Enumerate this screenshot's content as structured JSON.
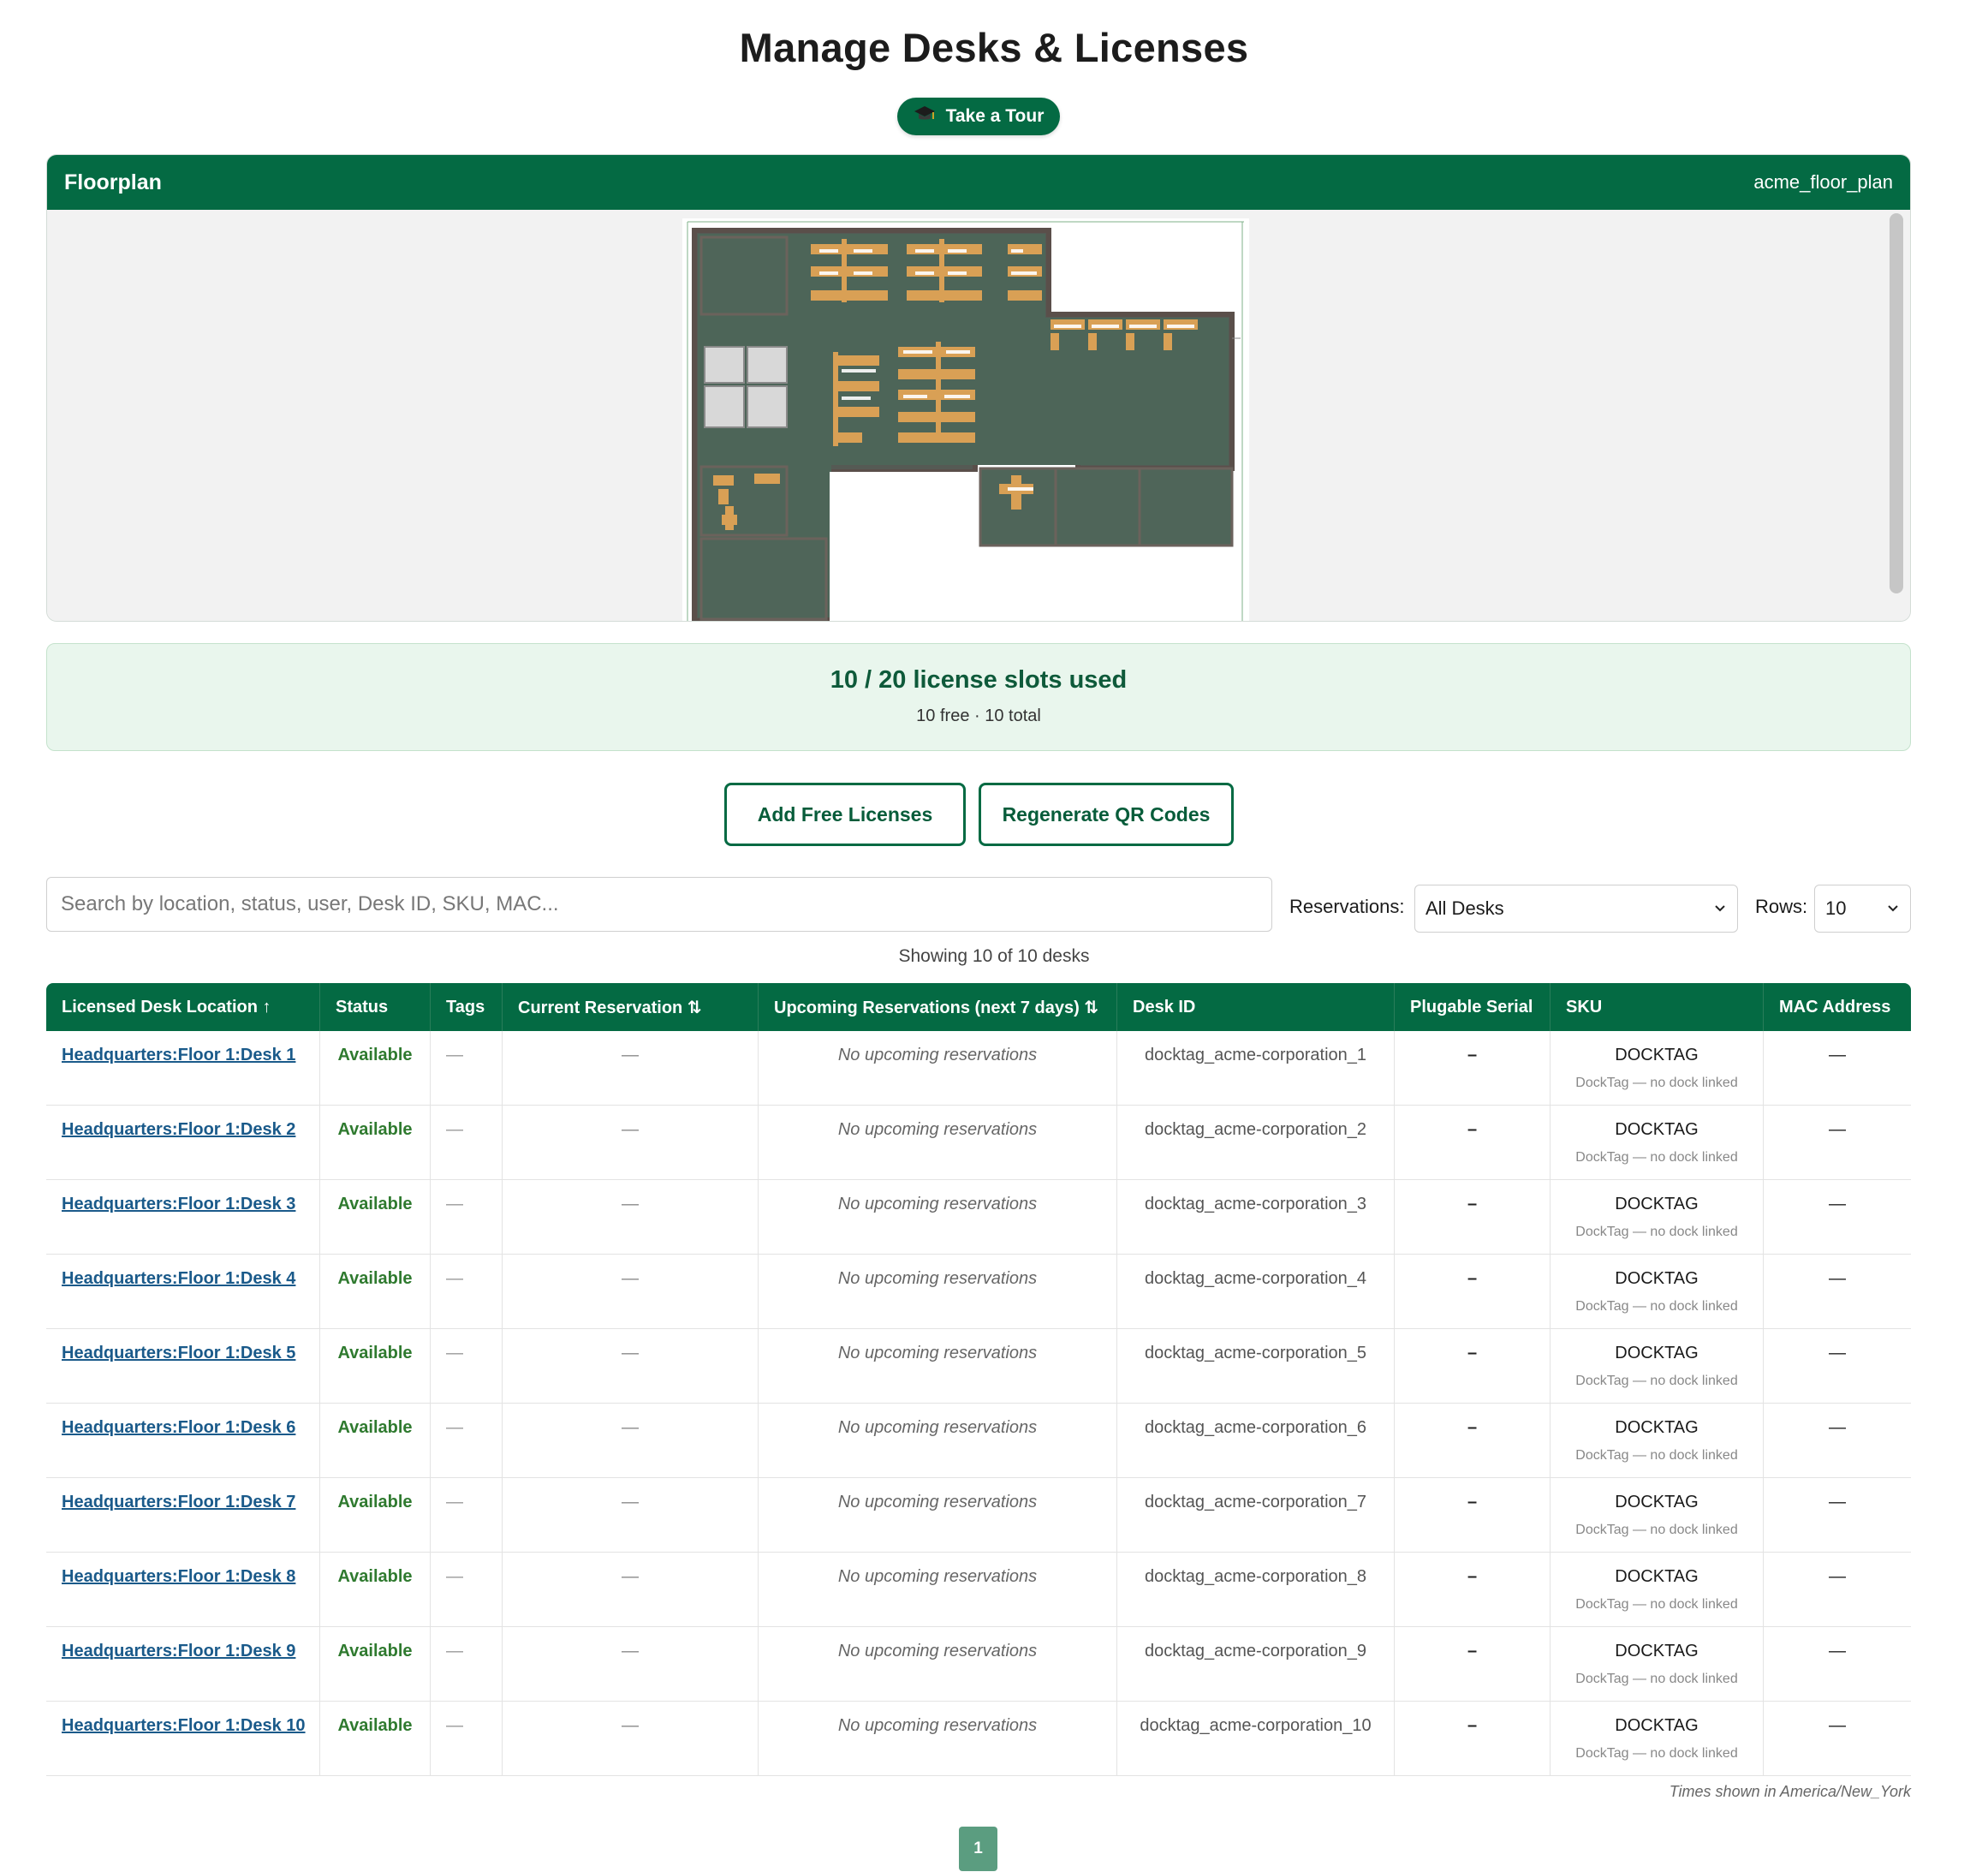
{
  "page": {
    "title": "Manage Desks & Licenses"
  },
  "tour": {
    "label": "Take a Tour",
    "icon": "graduation-cap-icon"
  },
  "floorplan": {
    "title": "Floorplan",
    "name": "acme_floor_plan"
  },
  "license": {
    "summary": "10 / 20 license slots used",
    "detail": "10 free · 10 total"
  },
  "actions": {
    "add_label": "Add Free Licenses",
    "regen_label": "Regenerate QR Codes"
  },
  "search": {
    "placeholder": "Search by location, status, user, Desk ID, SKU, MAC..."
  },
  "filters": {
    "reservations_label": "Reservations:",
    "reservations_value": "All Desks",
    "rows_label": "Rows:",
    "rows_value": "10"
  },
  "showing": "Showing 10 of 10 desks",
  "table": {
    "columns": [
      "Licensed Desk Location ↑",
      "Status",
      "Tags",
      "Current Reservation ⇅",
      "Upcoming Reservations (next 7 days) ⇅",
      "Desk ID",
      "Plugable Serial",
      "SKU",
      "MAC Address"
    ],
    "rows": [
      {
        "location": "Headquarters:Floor 1:Desk 1",
        "status": "Available",
        "tags": "—",
        "current": "—",
        "upcoming": "No upcoming reservations",
        "desk_id": "docktag_acme-corporation_1",
        "serial": "–",
        "sku": "DOCKTAG",
        "sku_note": "DockTag — no dock linked",
        "mac": "—"
      },
      {
        "location": "Headquarters:Floor 1:Desk 2",
        "status": "Available",
        "tags": "—",
        "current": "—",
        "upcoming": "No upcoming reservations",
        "desk_id": "docktag_acme-corporation_2",
        "serial": "–",
        "sku": "DOCKTAG",
        "sku_note": "DockTag — no dock linked",
        "mac": "—"
      },
      {
        "location": "Headquarters:Floor 1:Desk 3",
        "status": "Available",
        "tags": "—",
        "current": "—",
        "upcoming": "No upcoming reservations",
        "desk_id": "docktag_acme-corporation_3",
        "serial": "–",
        "sku": "DOCKTAG",
        "sku_note": "DockTag — no dock linked",
        "mac": "—"
      },
      {
        "location": "Headquarters:Floor 1:Desk 4",
        "status": "Available",
        "tags": "—",
        "current": "—",
        "upcoming": "No upcoming reservations",
        "desk_id": "docktag_acme-corporation_4",
        "serial": "–",
        "sku": "DOCKTAG",
        "sku_note": "DockTag — no dock linked",
        "mac": "—"
      },
      {
        "location": "Headquarters:Floor 1:Desk 5",
        "status": "Available",
        "tags": "—",
        "current": "—",
        "upcoming": "No upcoming reservations",
        "desk_id": "docktag_acme-corporation_5",
        "serial": "–",
        "sku": "DOCKTAG",
        "sku_note": "DockTag — no dock linked",
        "mac": "—"
      },
      {
        "location": "Headquarters:Floor 1:Desk 6",
        "status": "Available",
        "tags": "—",
        "current": "—",
        "upcoming": "No upcoming reservations",
        "desk_id": "docktag_acme-corporation_6",
        "serial": "–",
        "sku": "DOCKTAG",
        "sku_note": "DockTag — no dock linked",
        "mac": "—"
      },
      {
        "location": "Headquarters:Floor 1:Desk 7",
        "status": "Available",
        "tags": "—",
        "current": "—",
        "upcoming": "No upcoming reservations",
        "desk_id": "docktag_acme-corporation_7",
        "serial": "–",
        "sku": "DOCKTAG",
        "sku_note": "DockTag — no dock linked",
        "mac": "—"
      },
      {
        "location": "Headquarters:Floor 1:Desk 8",
        "status": "Available",
        "tags": "—",
        "current": "—",
        "upcoming": "No upcoming reservations",
        "desk_id": "docktag_acme-corporation_8",
        "serial": "–",
        "sku": "DOCKTAG",
        "sku_note": "DockTag — no dock linked",
        "mac": "—"
      },
      {
        "location": "Headquarters:Floor 1:Desk 9",
        "status": "Available",
        "tags": "—",
        "current": "—",
        "upcoming": "No upcoming reservations",
        "desk_id": "docktag_acme-corporation_9",
        "serial": "–",
        "sku": "DOCKTAG",
        "sku_note": "DockTag — no dock linked",
        "mac": "—"
      },
      {
        "location": "Headquarters:Floor 1:Desk 10",
        "status": "Available",
        "tags": "—",
        "current": "—",
        "upcoming": "No upcoming reservations",
        "desk_id": "docktag_acme-corporation_10",
        "serial": "–",
        "sku": "DOCKTAG",
        "sku_note": "DockTag — no dock linked",
        "mac": "—"
      }
    ]
  },
  "timezone_note": "Times shown in America/New_York",
  "pagination": {
    "current": "1"
  },
  "colors": {
    "brand": "#046a43",
    "status_available": "#2f7a2f",
    "link": "#1a5a8a",
    "license_bg": "#e9f6ed"
  }
}
